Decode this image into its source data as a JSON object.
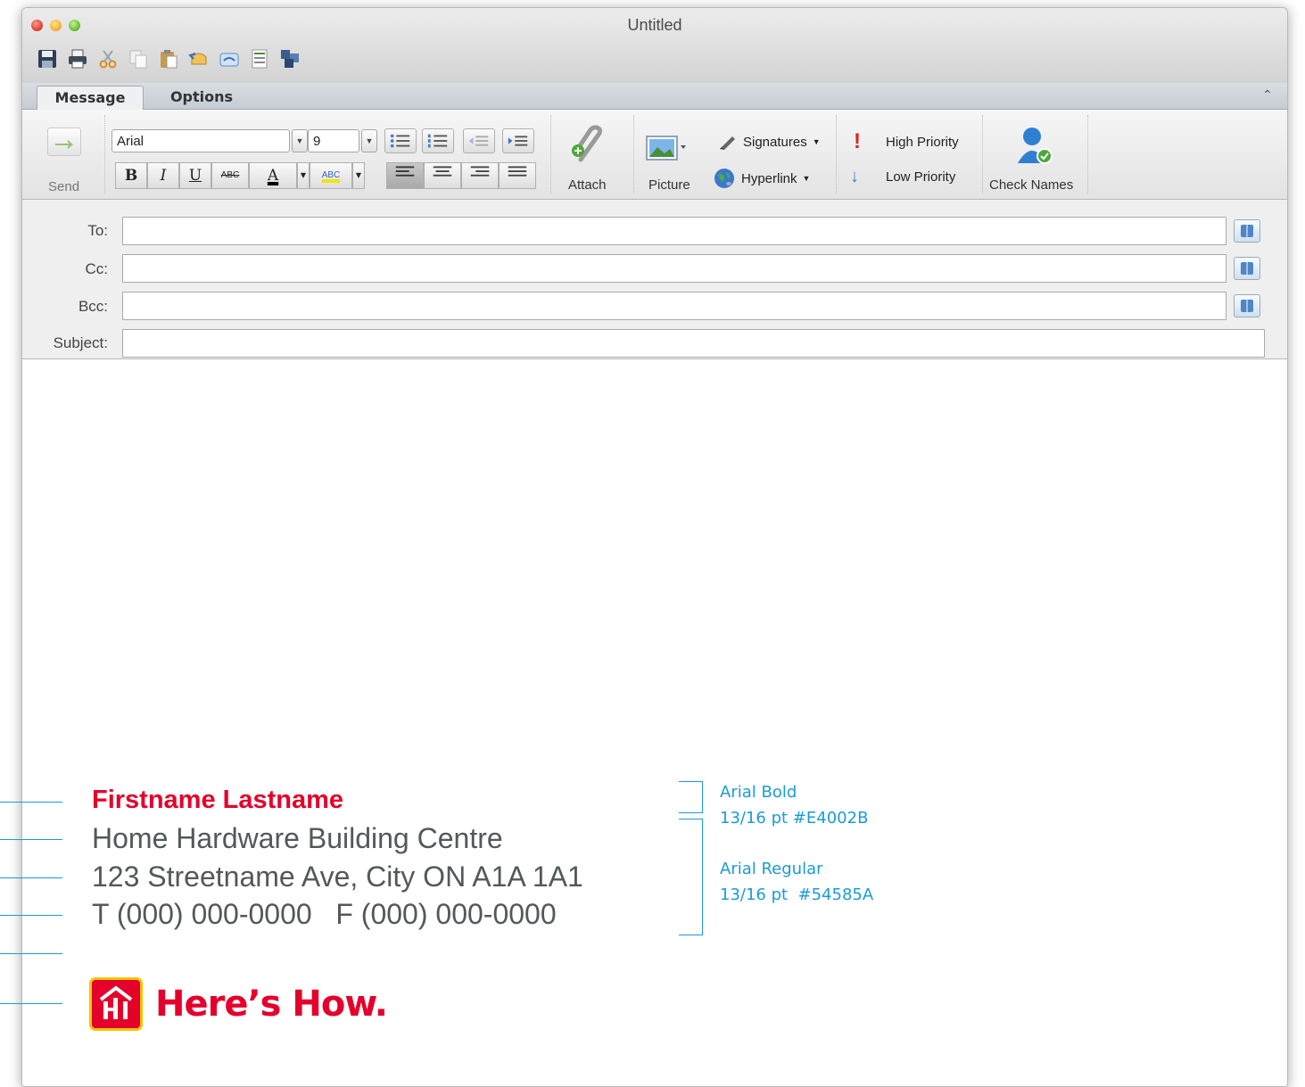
{
  "window": {
    "title": "Untitled"
  },
  "toolbar": {
    "buttons": [
      "save-icon",
      "print-icon",
      "cut-icon",
      "copy-icon",
      "paste-icon",
      "undo-icon",
      "redo-icon",
      "format-icon",
      "window-icon"
    ]
  },
  "tabs": [
    {
      "label": "Message",
      "active": true
    },
    {
      "label": "Options",
      "active": false
    }
  ],
  "ribbon": {
    "send_label": "Send",
    "font_name": "Arial",
    "font_size": "9",
    "bold": "B",
    "italic": "I",
    "underline": "U",
    "strike": "ABC",
    "font_color": "A",
    "highlight": "ABC",
    "attach_label": "Attach",
    "picture_label": "Picture",
    "signatures_label": "Signatures",
    "hyperlink_label": "Hyperlink",
    "high_priority_label": "High Priority",
    "low_priority_label": "Low Priority",
    "check_names_label": "Check Names"
  },
  "fields": {
    "to_label": "To:",
    "cc_label": "Cc:",
    "bcc_label": "Bcc:",
    "subject_label": "Subject:",
    "to_value": "",
    "cc_value": "",
    "bcc_value": "",
    "subject_value": ""
  },
  "signature": {
    "name": "Firstname Lastname",
    "company": "Home Hardware Building Centre",
    "address": "123 Streetname Ave, City ON A1A 1A1",
    "phone": "T (000) 000-0000   F (000) 000-0000",
    "logo_text": "Here’s How.",
    "name_color": "#E4002B",
    "text_color": "#54585A"
  },
  "spec_notes": {
    "bold_font": "Arial Bold",
    "bold_spec": "13/16 pt #E4002B",
    "regular_font": "Arial Regular",
    "regular_spec": "13/16 pt  #54585A",
    "note_color": "#1A9BD7"
  }
}
